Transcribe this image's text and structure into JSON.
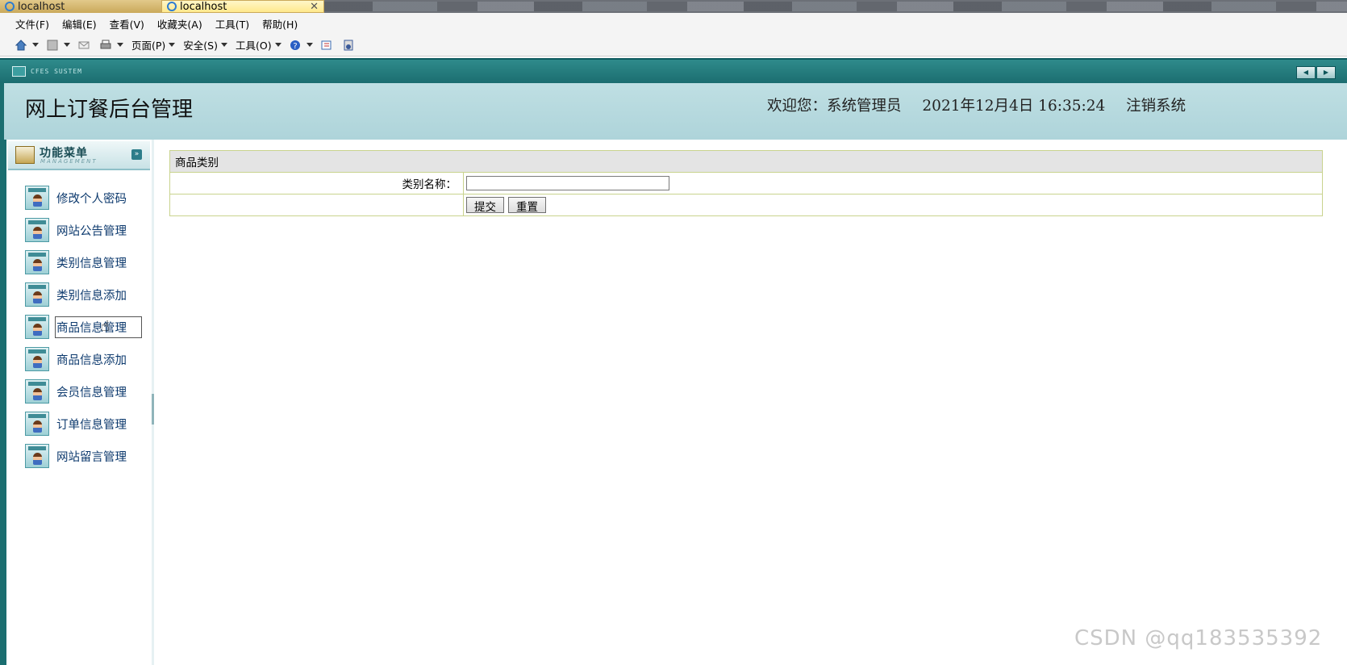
{
  "browser": {
    "tabs": [
      {
        "title": "localhost"
      },
      {
        "title": "localhost",
        "close": "✕"
      }
    ],
    "menu": [
      "文件(F)",
      "编辑(E)",
      "查看(V)",
      "收藏夹(A)",
      "工具(T)",
      "帮助(H)"
    ],
    "commands": {
      "page": "页面(P)",
      "safety": "安全(S)",
      "tools": "工具(O)"
    }
  },
  "frame": {
    "label": "CFES SUSTEM"
  },
  "header": {
    "title": "网上订餐后台管理",
    "welcome": "欢迎您：系统管理员",
    "datetime": "2021年12月4日 16:35:24",
    "logout": "注销系统"
  },
  "sidebar": {
    "title": "功能菜单",
    "subtitle": "MANAGEMENT",
    "items": [
      {
        "label": "修改个人密码"
      },
      {
        "label": "网站公告管理"
      },
      {
        "label": "类别信息管理"
      },
      {
        "label": "类别信息添加"
      },
      {
        "label": "商品信息管理"
      },
      {
        "label": "商品信息添加"
      },
      {
        "label": "会员信息管理"
      },
      {
        "label": "订单信息管理"
      },
      {
        "label": "网站留言管理"
      }
    ]
  },
  "form": {
    "title": "商品类别",
    "field_label": "类别名称：",
    "field_value": "",
    "submit": "提交",
    "reset": "重置"
  },
  "watermark": "CSDN @qq183535392"
}
